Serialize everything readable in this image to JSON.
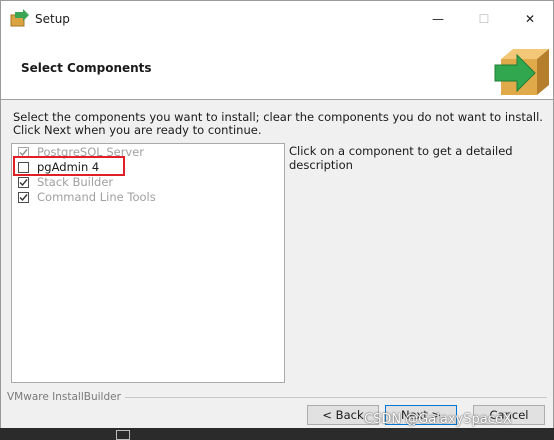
{
  "window": {
    "title": "Setup",
    "min_glyph": "—",
    "max_glyph": "☐",
    "close_glyph": "✕"
  },
  "header": {
    "title": "Select Components"
  },
  "instructions": "Select the components you want to install; clear the components you do not want to install. Click Next when you are ready to continue.",
  "components": [
    {
      "label": "PostgreSQL Server",
      "checked": true,
      "disabled": true
    },
    {
      "label": "pgAdmin 4",
      "checked": false,
      "disabled": false
    },
    {
      "label": "Stack Builder",
      "checked": true,
      "disabled": false
    },
    {
      "label": "Command Line Tools",
      "checked": true,
      "disabled": false
    }
  ],
  "description": "Click on a component to get a detailed description",
  "branding": "VMware InstallBuilder",
  "buttons": {
    "back": "< Back",
    "next": "Next >",
    "cancel": "Cancel"
  },
  "watermark": "CSDN @GalaxySpaceX",
  "colors": {
    "highlight": "#e01f26",
    "focus": "#0078d7"
  },
  "icons": {
    "app": "setup-arrow-box-icon",
    "header": "box-arrow-icon"
  }
}
